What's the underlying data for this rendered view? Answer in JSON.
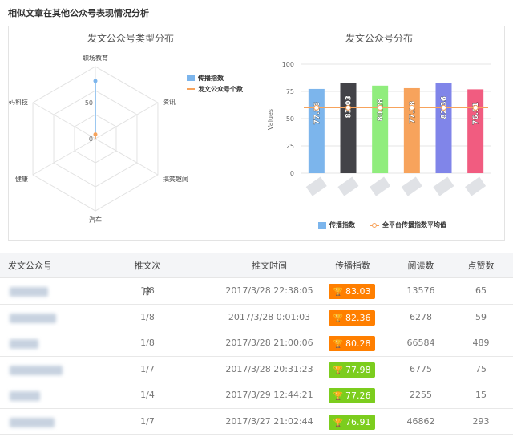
{
  "page": {
    "title": "相似文章在其他公众号表现情况分析"
  },
  "radar": {
    "title": "发文公众号类型分布",
    "axes": [
      "职场教育",
      "资讯",
      "搞笑趣闻",
      "汽车",
      "健康",
      "数码科技"
    ],
    "ticks": [
      "0",
      "50"
    ],
    "legend": [
      "传播指数",
      "发文公众号个数"
    ],
    "colors": {
      "series1": "#7cb5ec",
      "series2": "#f7a35c"
    }
  },
  "bar": {
    "title": "发文公众号分布",
    "ylabel": "Values",
    "ticks": [
      "0",
      "25",
      "50",
      "75",
      "100"
    ],
    "legend": [
      "传播指数",
      "全平台传播指数平均值"
    ]
  },
  "chart_data": [
    {
      "type": "radar",
      "title": "发文公众号类型分布",
      "axes": [
        "职场教育",
        "资讯",
        "搞笑趣闻",
        "汽车",
        "健康",
        "数码科技"
      ],
      "ylim": [
        0,
        100
      ],
      "series": [
        {
          "name": "传播指数",
          "values": [
            80,
            0,
            0,
            0,
            0,
            0
          ]
        },
        {
          "name": "发文公众号个数",
          "values": [
            6,
            0,
            0,
            0,
            0,
            0
          ]
        }
      ],
      "legend": "right"
    },
    {
      "type": "bar",
      "title": "发文公众号分布",
      "ylabel": "Values",
      "ylim": [
        0,
        100
      ],
      "values": [
        77.26,
        83.03,
        80.28,
        77.98,
        82.36,
        76.91
      ],
      "labels": [
        "77.26",
        "83.03",
        "80.28",
        "77.98",
        "82.36",
        "76.91"
      ],
      "colors": [
        "#7cb5ec",
        "#434348",
        "#90ed7d",
        "#f7a35c",
        "#8085e9",
        "#f15c80"
      ],
      "reference_line": {
        "name": "全平台传播指数平均值",
        "value": 60,
        "color": "#f7a35c"
      },
      "grid": true,
      "legend": "bottom"
    }
  ],
  "table": {
    "headers": [
      "发文公众号",
      "推文次序",
      "推文时间",
      "传播指数",
      "阅读数",
      "点赞数"
    ],
    "rows": [
      {
        "order": "1/8",
        "time": "2017/3/28 22:38:05",
        "index": "83.03",
        "index_color": "#ff7f00",
        "reads": "13576",
        "likes": "65"
      },
      {
        "order": "1/8",
        "time": "2017/3/28 0:01:03",
        "index": "82.36",
        "index_color": "#ff7f00",
        "reads": "6278",
        "likes": "59"
      },
      {
        "order": "1/8",
        "time": "2017/3/28 21:00:06",
        "index": "80.28",
        "index_color": "#ff7f00",
        "reads": "66584",
        "likes": "489"
      },
      {
        "order": "1/7",
        "time": "2017/3/28 20:31:23",
        "index": "77.98",
        "index_color": "#7ccd1e",
        "reads": "6775",
        "likes": "75"
      },
      {
        "order": "1/4",
        "time": "2017/3/29 12:44:21",
        "index": "77.26",
        "index_color": "#7ccd1e",
        "reads": "2255",
        "likes": "15"
      },
      {
        "order": "1/7",
        "time": "2017/3/27 21:02:44",
        "index": "76.91",
        "index_color": "#7ccd1e",
        "reads": "46862",
        "likes": "293"
      }
    ]
  }
}
